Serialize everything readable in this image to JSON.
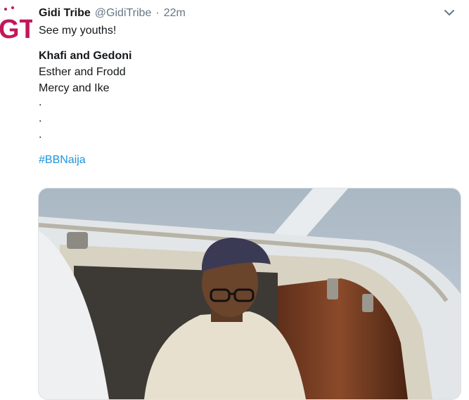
{
  "tweet": {
    "display_name": "Gidi Tribe",
    "handle": "@GidiTribe",
    "separator": "·",
    "time": "22m",
    "lines": {
      "l1": "See my youths!",
      "l2": "Khafi and Gedoni",
      "l3": "Esther and Frodd",
      "l4": "Mercy and Ike",
      "d1": ".",
      "d2": ".",
      "d3": ".",
      "hashtag": "#BBNaija"
    },
    "avatar_logo_text": "GT",
    "menu_icon": "chevron-down-icon",
    "colors": {
      "link": "#1b95e0",
      "logo": "#c2185b",
      "muted": "#657786"
    }
  }
}
